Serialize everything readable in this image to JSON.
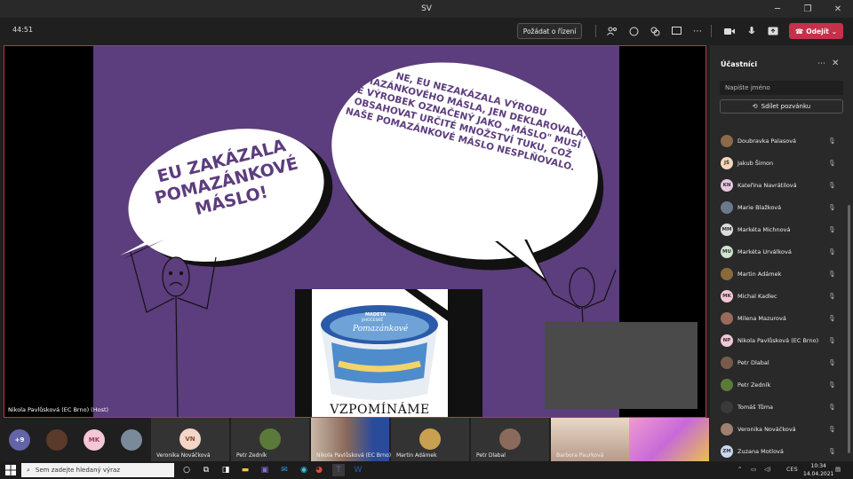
{
  "window": {
    "title": "SV"
  },
  "toolbar": {
    "timer": "44:51",
    "request_control_label": "Požádat o řízení",
    "leave_label": "Odejít"
  },
  "slide": {
    "left_bubble": "EU ZAKÁZALA POMAZÁNKOVÉ MÁSLO!",
    "right_bubble": "NE, EU NEZAKÁZALA VÝROBU POMAZÁNKOVÉHO MÁSLA, JEN DEKLAROVALA, ŽE VÝROBEK OZNAČENÝ JAKO „MÁSLO\" MUSÍ OBSAHOVAT URČITÉ MNOŽSTVÍ TUKU, COŽ NAŠE POMAZÁNKOVÉ MÁSLO NESPLŇOVALO.",
    "memorial_caption": "VZPOMÍNÁME",
    "product_brand": "MADETA",
    "product_line": "JIHOČESKÉ",
    "product_name": "Pomazánkové"
  },
  "stage": {
    "presenter_label": "Nikola Pavlůsková (EC Brno) (Host)"
  },
  "sidebar": {
    "title": "Účastníci",
    "search_placeholder": "Napište jméno",
    "invite_label": "Sdílet pozvánku",
    "participants": [
      {
        "name": "Doubravka Palasová",
        "initials": "",
        "avatar_color": "#8a6a4a",
        "photo": true
      },
      {
        "name": "Jakub Šimon",
        "initials": "JŠ",
        "avatar_color": "#f5d6b8",
        "photo": false
      },
      {
        "name": "Kateřina Navrátilová",
        "initials": "KN",
        "avatar_color": "#e8c6e0",
        "photo": false
      },
      {
        "name": "Marie Blažková",
        "initials": "",
        "avatar_color": "#6a7a8a",
        "photo": true
      },
      {
        "name": "Markéta Michnová",
        "initials": "MM",
        "avatar_color": "#dcdcdc",
        "photo": false
      },
      {
        "name": "Markéta Urválková",
        "initials": "MU",
        "avatar_color": "#cfe3cf",
        "photo": false
      },
      {
        "name": "Martin Adámek",
        "initials": "",
        "avatar_color": "#8a6a3a",
        "photo": true
      },
      {
        "name": "Michal Kadlec",
        "initials": "MK",
        "avatar_color": "#f3c7d6",
        "photo": false
      },
      {
        "name": "Milena Mazurová",
        "initials": "",
        "avatar_color": "#9a6a5a",
        "photo": true
      },
      {
        "name": "Nikola Pavlůsková (EC Brno)",
        "initials": "NP",
        "avatar_color": "#f3c7d6",
        "photo": false
      },
      {
        "name": "Petr Dlabal",
        "initials": "",
        "avatar_color": "#7a5a4a",
        "photo": true
      },
      {
        "name": "Petr Zedník",
        "initials": "",
        "avatar_color": "#5a7a3a",
        "photo": true
      },
      {
        "name": "Tomáš Tůma",
        "initials": "",
        "avatar_color": "#3a3a3a",
        "photo": true
      },
      {
        "name": "Veronika Nováčková",
        "initials": "",
        "avatar_color": "#a08070",
        "photo": true
      },
      {
        "name": "Zuzana Motlová",
        "initials": "ZM",
        "avatar_color": "#c8d8f0",
        "photo": false
      }
    ]
  },
  "strip": {
    "overflow_count": "+9",
    "mk_initials": "MK",
    "vn_initials": "VN",
    "tiles": [
      {
        "label": "Veronika Nováčková"
      },
      {
        "label": "Petr Zedník"
      },
      {
        "label": "Nikola Pavlůsková (EC Brno)"
      },
      {
        "label": "Martin Adámek"
      },
      {
        "label": "Petr Dlabal"
      },
      {
        "label": "Barbora Paurková"
      }
    ]
  },
  "taskbar": {
    "search_placeholder": "Sem zadejte hledaný výraz",
    "language": "CES",
    "time": "10:34",
    "date": "14.04.2021"
  },
  "colors": {
    "slide_bg": "#5c3d7d",
    "leave": "#c4314b",
    "accent": "#6264a7"
  }
}
